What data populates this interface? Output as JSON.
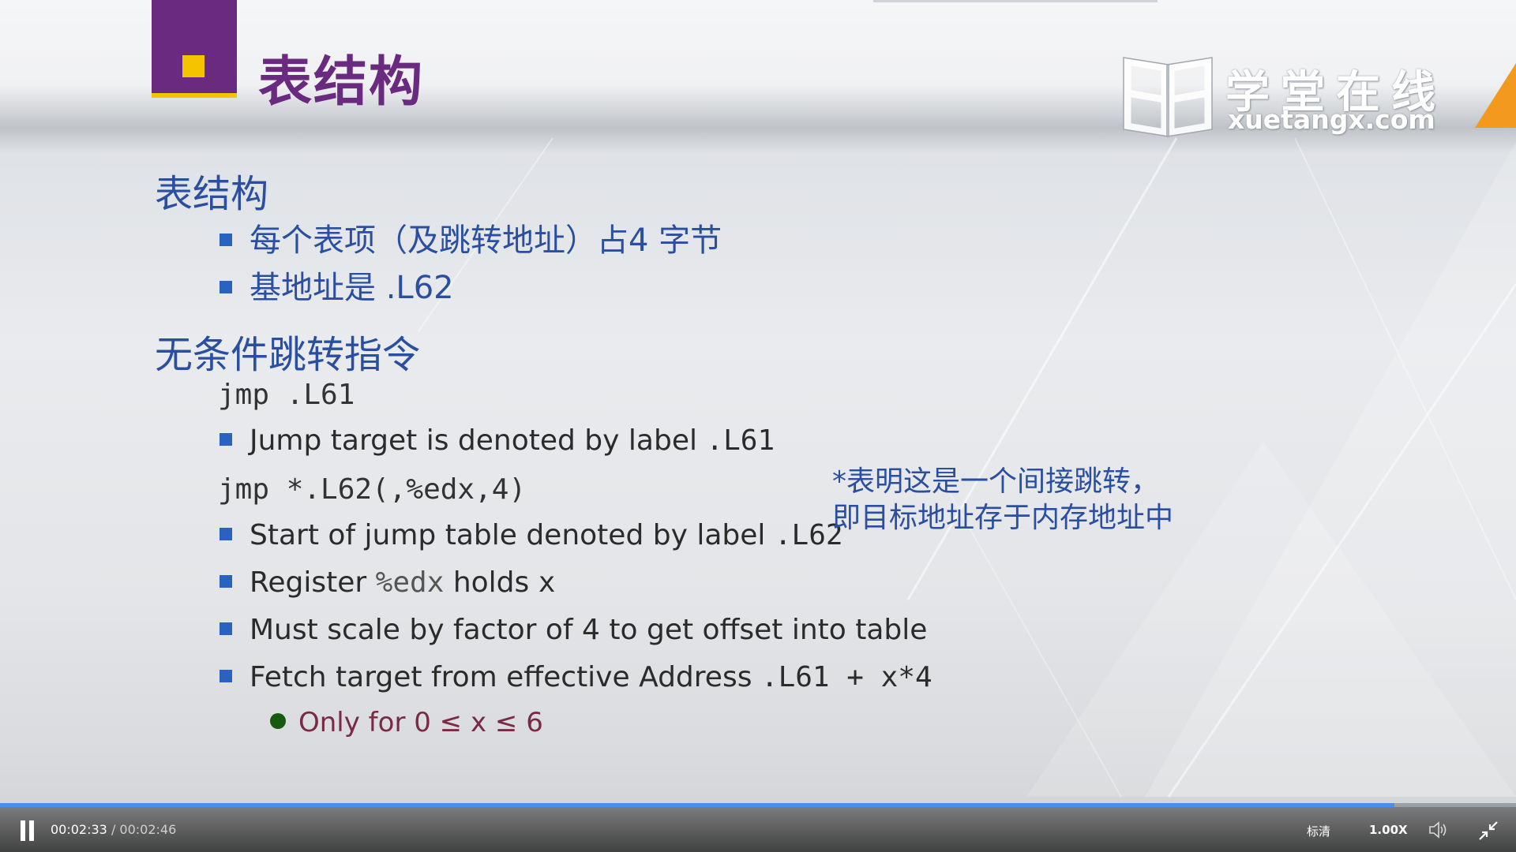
{
  "slide": {
    "title": "表结构",
    "watermark_cn": "学堂在线",
    "watermark_en": "xuetangx.com",
    "section1_heading": "表结构",
    "section1_items": [
      "每个表项（及跳转地址）占4 字节",
      "基地址是 .L62"
    ],
    "section2_heading": "无条件跳转指令",
    "code1": "jmp .L61",
    "item_jump_target_text": "Jump target is denoted by label ",
    "item_jump_target_code": ".L61",
    "code2": "jmp *.L62(,%edx,4)",
    "item_start_text": "Start of jump table denoted by label ",
    "item_start_code": ".L62",
    "item_register_text1": "Register ",
    "item_register_code1": "%edx",
    "item_register_text2": " holds ",
    "item_register_code2": "x",
    "item_scale": "Must scale by factor of 4 to get offset into table",
    "item_fetch_text": "Fetch target from effective Address ",
    "item_fetch_code": ".L61 + x*4",
    "sub_item_text": "Only for  0 ≤ x ≤ 6",
    "note_line1": "*表明这是一个间接跳转，",
    "note_line2": "即目标地址存于内存地址中"
  },
  "player": {
    "current_time": "00:02:33",
    "separator": " / ",
    "duration": "00:02:46",
    "progress_fraction": 0.92,
    "quality_label": "标清",
    "speed_label": "1.00X",
    "accent_color": "#4a8ff0"
  }
}
